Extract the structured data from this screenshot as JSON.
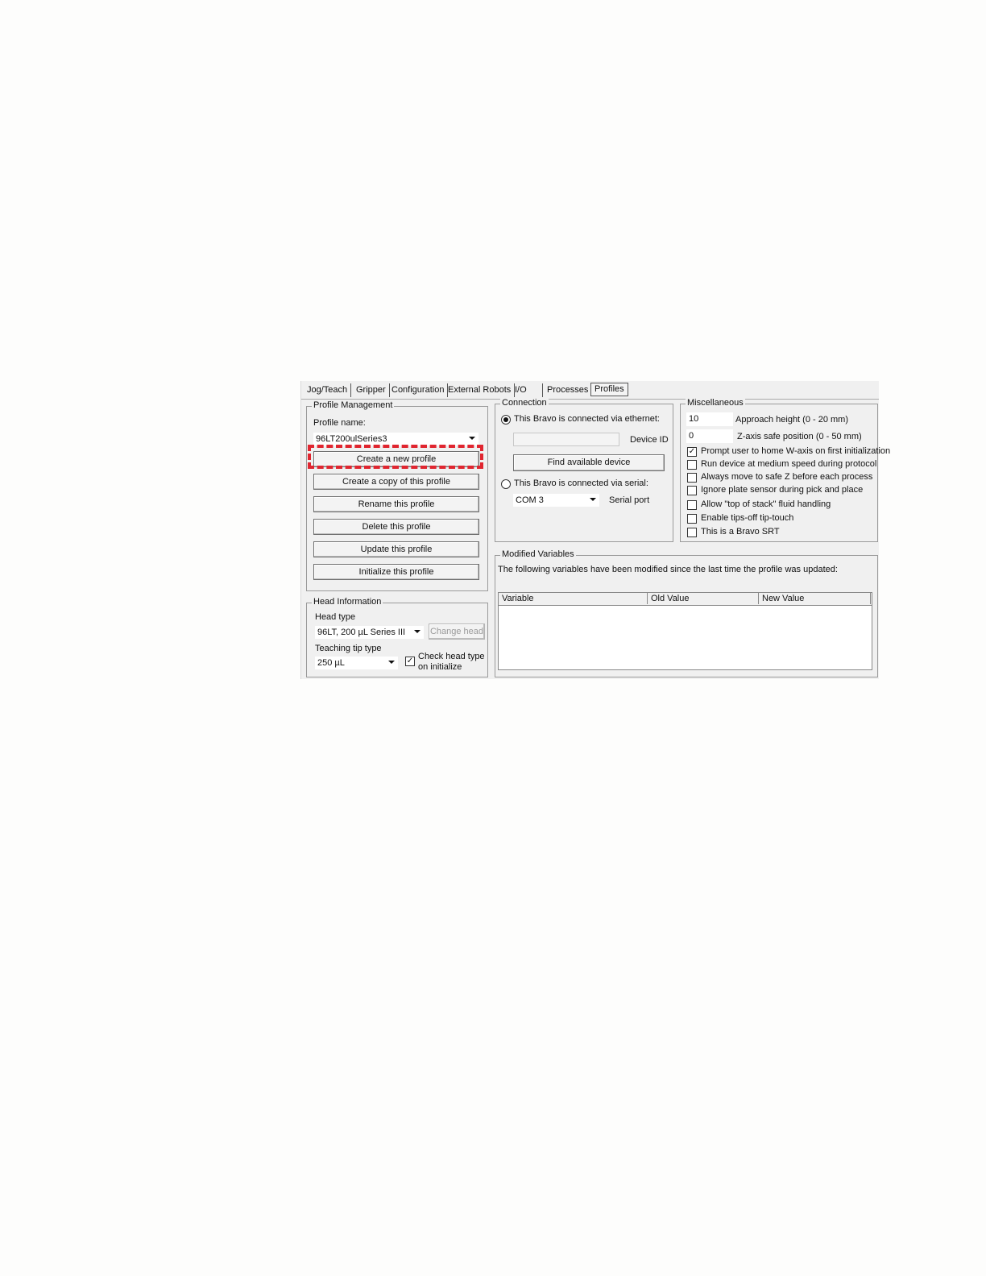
{
  "tabs": [
    {
      "label": "Jog/Teach"
    },
    {
      "label": "Gripper"
    },
    {
      "label": "Configuration"
    },
    {
      "label": "External Robots"
    },
    {
      "label": "I/O"
    },
    {
      "label": "Processes"
    },
    {
      "label": "Profiles",
      "active": true
    }
  ],
  "profile_management": {
    "title": "Profile Management",
    "name_label": "Profile name:",
    "name_value": "96LT200ulSeries3",
    "buttons": [
      "Create a new profile",
      "Create a copy of this profile",
      "Rename this profile",
      "Delete this profile",
      "Update this profile",
      "Initialize this profile"
    ]
  },
  "head_information": {
    "title": "Head Information",
    "head_type_label": "Head type",
    "head_type_value": "96LT, 200 µL Series III",
    "change_head": "Change head",
    "teaching_tip_label": "Teaching tip type",
    "teaching_tip_value": "250 µL",
    "check_head_line1": "Check head type",
    "check_head_line2": "on initialize",
    "check_head_checked": true
  },
  "connection": {
    "title": "Connection",
    "ethernet_label": "This Bravo is connected via ethernet:",
    "ethernet_selected": true,
    "device_id_label": "Device ID",
    "device_id_value": "",
    "find_button": "Find available device",
    "serial_label": "This Bravo is connected via serial:",
    "serial_value": "COM 3",
    "serial_port_label": "Serial port"
  },
  "misc": {
    "title": "Miscellaneous",
    "approach_value": "10",
    "approach_label": "Approach height (0 - 20 mm)",
    "zaxis_value": "0",
    "zaxis_label": "Z-axis safe position (0 - 50 mm)",
    "options": [
      {
        "label": "Prompt user to home W-axis on first initialization",
        "checked": true
      },
      {
        "label": "Run device at medium speed during protocol",
        "checked": false
      },
      {
        "label": "Always move to safe Z before each process",
        "checked": false
      },
      {
        "label": "Ignore plate sensor during pick and place",
        "checked": false
      },
      {
        "label": "Allow \"top of stack\" fluid handling",
        "checked": false
      },
      {
        "label": "Enable tips-off tip-touch",
        "checked": false
      },
      {
        "label": "This is a Bravo SRT",
        "checked": false
      }
    ]
  },
  "modified_variables": {
    "title": "Modified Variables",
    "description": "The following variables have been modified since the last time the profile was updated:",
    "columns": [
      "Variable",
      "Old Value",
      "New Value"
    ]
  },
  "colors": {
    "highlight": "#e0252f"
  }
}
